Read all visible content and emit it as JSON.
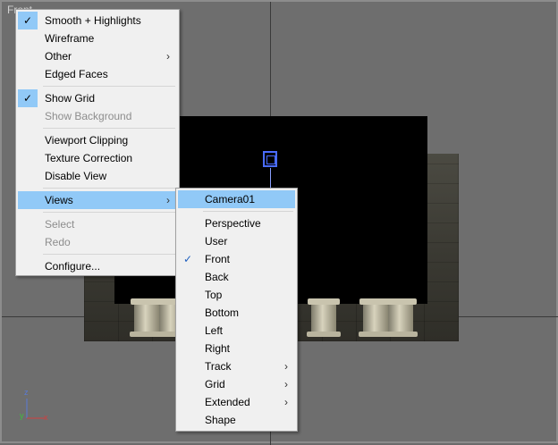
{
  "viewport": {
    "label": "Front"
  },
  "axis": {
    "z": "z",
    "y": "y",
    "x": "x"
  },
  "main_menu": {
    "items": [
      {
        "label": "Smooth + Highlights",
        "checked": true
      },
      {
        "label": "Wireframe"
      },
      {
        "label": "Other",
        "submenu": true
      },
      {
        "label": "Edged Faces"
      },
      {
        "label": "Show Grid",
        "checked": true
      },
      {
        "label": "Show Background",
        "disabled": true
      },
      {
        "label": "Viewport Clipping"
      },
      {
        "label": "Texture Correction"
      },
      {
        "label": "Disable View"
      },
      {
        "label": "Views",
        "submenu": true,
        "highlighted": true
      },
      {
        "label": "Select",
        "disabled": true
      },
      {
        "label": "Redo",
        "disabled": true
      },
      {
        "label": "Configure..."
      }
    ],
    "arrow": "›",
    "check": "✓"
  },
  "views_menu": {
    "items": [
      {
        "label": "Camera01",
        "highlighted": true
      },
      {
        "label": "Perspective"
      },
      {
        "label": "User"
      },
      {
        "label": "Front",
        "checked": true
      },
      {
        "label": "Back"
      },
      {
        "label": "Top"
      },
      {
        "label": "Bottom"
      },
      {
        "label": "Left"
      },
      {
        "label": "Right"
      },
      {
        "label": "Track",
        "submenu": true
      },
      {
        "label": "Grid",
        "submenu": true
      },
      {
        "label": "Extended",
        "submenu": true
      },
      {
        "label": "Shape"
      }
    ]
  }
}
